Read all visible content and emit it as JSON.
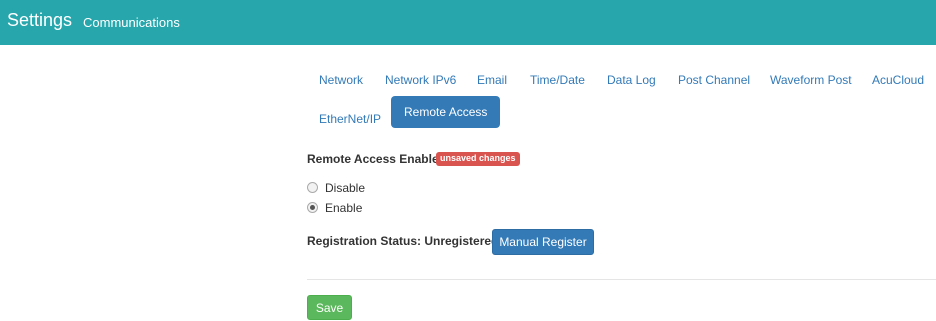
{
  "header": {
    "title": "Settings",
    "subtitle": "Communications",
    "background": "#27a6ac"
  },
  "tabs": [
    {
      "label": "Network",
      "active": false
    },
    {
      "label": "Network IPv6",
      "active": false
    },
    {
      "label": "Email",
      "active": false
    },
    {
      "label": "Time/Date",
      "active": false
    },
    {
      "label": "Data Log",
      "active": false
    },
    {
      "label": "Post Channel",
      "active": false
    },
    {
      "label": "Waveform Post",
      "active": false
    },
    {
      "label": "AcuCloud",
      "active": false
    },
    {
      "label": "EtherNet/IP",
      "active": false
    },
    {
      "label": "Remote Access",
      "active": true
    }
  ],
  "remote_access": {
    "enable_label": "Remote Access Enable",
    "badge": "unsaved changes",
    "options": [
      {
        "label": "Disable",
        "checked": false
      },
      {
        "label": "Enable",
        "checked": true
      }
    ],
    "status_label": "Registration Status: Unregistered",
    "register_button": "Manual Register"
  },
  "save_button": "Save",
  "colors": {
    "primary": "#337ab7",
    "success": "#5cb85c",
    "danger": "#d9534f"
  }
}
